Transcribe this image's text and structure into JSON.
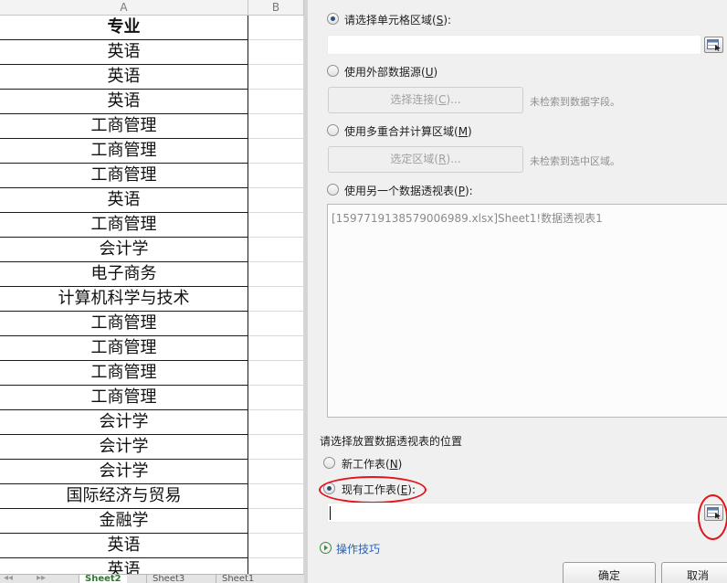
{
  "sheet": {
    "columns": [
      "A",
      "B"
    ],
    "header": "专业",
    "rows": [
      "英语",
      "英语",
      "英语",
      "工商管理",
      "工商管理",
      "工商管理",
      "英语",
      "工商管理",
      "会计学",
      "电子商务",
      "计算机科学与技术",
      "工商管理",
      "工商管理",
      "工商管理",
      "工商管理",
      "会计学",
      "会计学",
      "会计学",
      "国际经济与贸易",
      "金融学",
      "英语",
      "英语"
    ],
    "tabs": [
      "Sheet2",
      "Sheet3",
      "Sheet1"
    ]
  },
  "dialog": {
    "opt_range": {
      "label": "请选择单元格区域(",
      "key": "S",
      "tail": "):",
      "value": ""
    },
    "opt_external": {
      "label": "使用外部数据源(",
      "key": "U",
      "tail": ")"
    },
    "choose_conn": {
      "label": "选择连接(",
      "key": "C",
      "tail": ")..."
    },
    "no_fields": "未检索到数据字段。",
    "opt_multi": {
      "label": "使用多重合并计算区域(",
      "key": "M",
      "tail": ")"
    },
    "select_range": {
      "label": "选定区域(",
      "key": "R",
      "tail": ")..."
    },
    "no_region": "未检索到选中区域。",
    "opt_other_pivot": {
      "label": "使用另一个数据透视表(",
      "key": "P",
      "tail": "):"
    },
    "pivot_list_item": "[1597719138579006989.xlsx]Sheet1!数据透视表1",
    "placement_title": "请选择放置数据透视表的位置",
    "opt_new_sheet": {
      "label": "新工作表(",
      "key": "N",
      "tail": ")"
    },
    "opt_existing_sheet": {
      "label": "现有工作表(",
      "key": "E",
      "tail": "):"
    },
    "location_value": "",
    "tips_link": "操作技巧",
    "ok": "确定",
    "cancel": "取消"
  },
  "colors": {
    "annotation": "#e0161c",
    "link": "#2b62b4"
  }
}
